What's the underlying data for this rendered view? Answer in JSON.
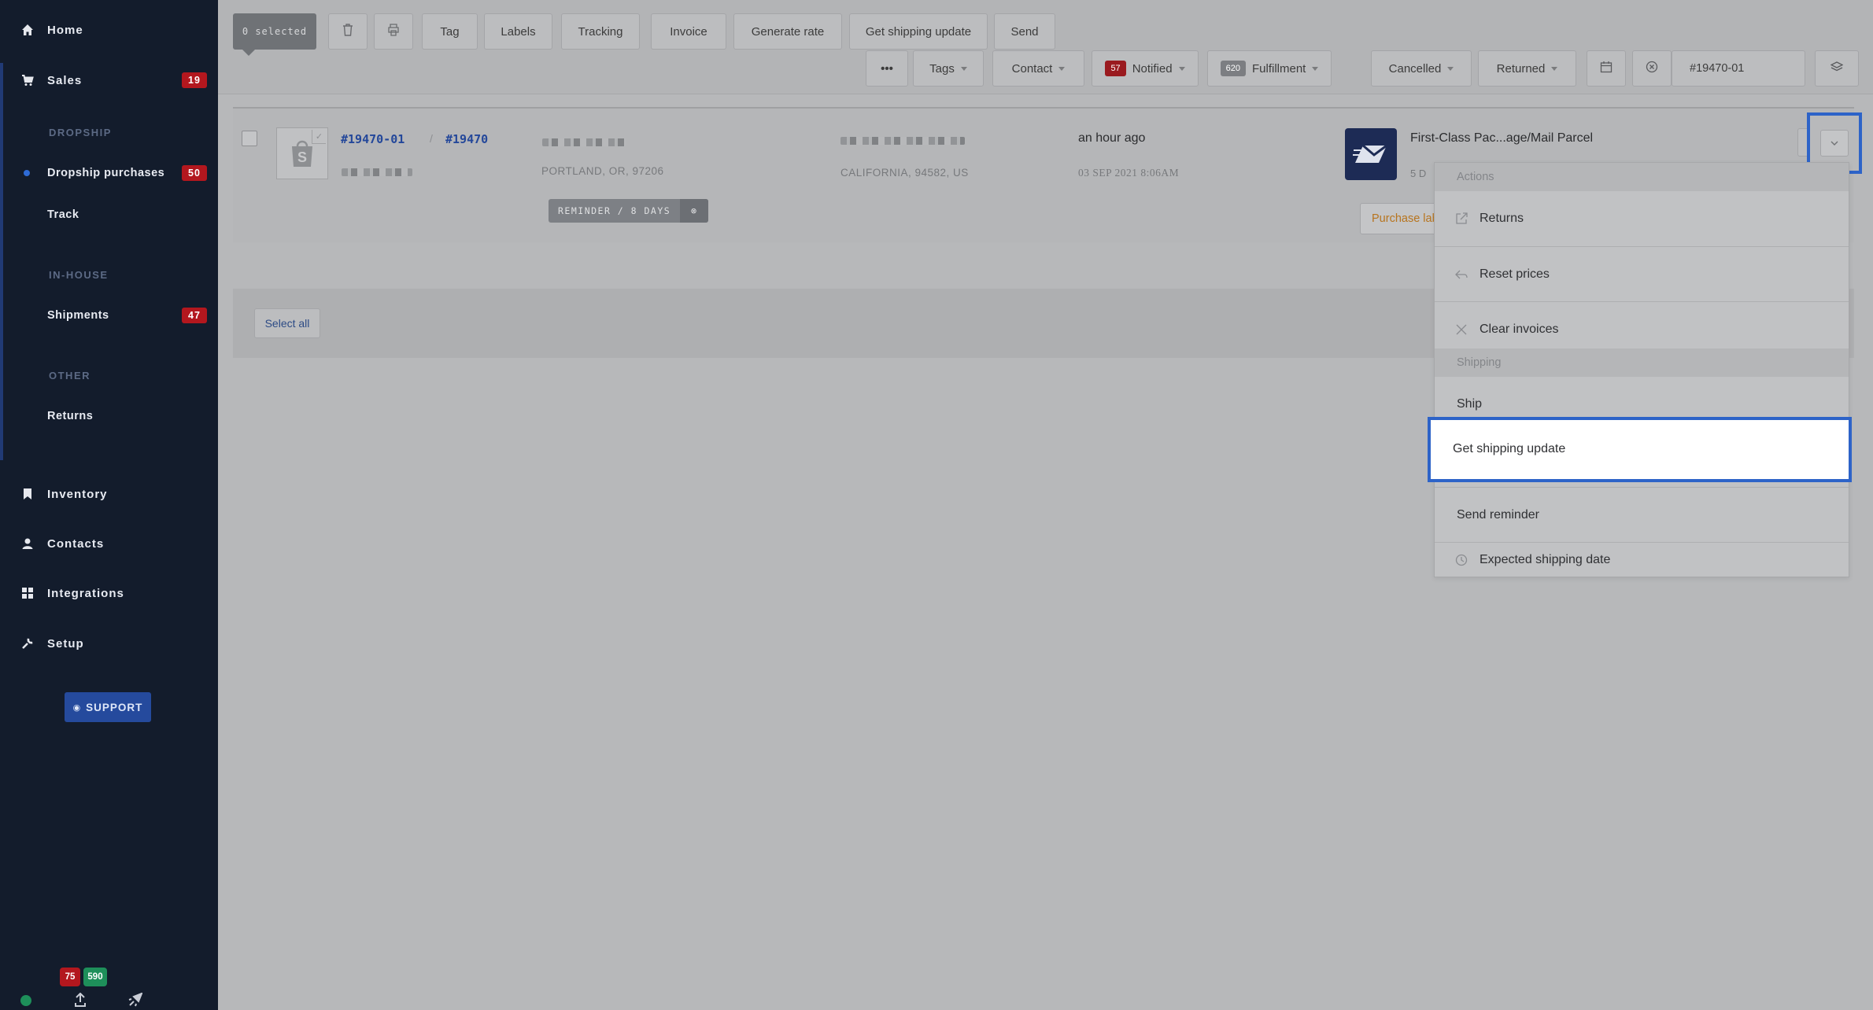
{
  "sidebar": {
    "home": "Home",
    "sales": {
      "label": "Sales",
      "badge": "19"
    },
    "dropship_section": "DROPSHIP",
    "dropship_purchases": {
      "label": "Dropship purchases",
      "badge": "50"
    },
    "track": "Track",
    "inhouse_section": "IN-HOUSE",
    "shipments": {
      "label": "Shipments",
      "badge": "47"
    },
    "other_section": "OTHER",
    "returns": "Returns",
    "inventory": "Inventory",
    "contacts": "Contacts",
    "integrations": "Integrations",
    "setup": "Setup",
    "support": "SUPPORT",
    "bottom_badge_red": "75",
    "bottom_badge_green": "590"
  },
  "toolbar": {
    "selected": "0 selected",
    "tag": "Tag",
    "labels": "Labels",
    "tracking": "Tracking",
    "invoice": "Invoice",
    "generate_rate": "Generate rate",
    "get_shipping_update": "Get shipping update",
    "send": "Send",
    "more": "•••",
    "tags": "Tags",
    "contact": "Contact",
    "notified": {
      "label": "Notified",
      "count": "57"
    },
    "fulfillment": {
      "label": "Fulfillment",
      "count": "620"
    },
    "cancelled": "Cancelled",
    "returned": "Returned",
    "search_value": "#19470-01"
  },
  "order": {
    "id": "#19470-01",
    "parent_id": "#19470",
    "from_location": "PORTLAND, OR, 97206",
    "to_location": "CALIFORNIA, 94582, US",
    "reminder": "REMINDER / 8 DAYS",
    "time_ago": "an hour ago",
    "date": "03 SEP 2021 8:06AM",
    "service": "First-Class Pac...age/Mail Parcel",
    "service_sub": "5  D",
    "purchase_label": "Purchase lab"
  },
  "select_all": "Select all",
  "dropdown": {
    "actions_header": "Actions",
    "returns": "Returns",
    "reset_prices": "Reset prices",
    "clear_invoices": "Clear invoices",
    "shipping_header": "Shipping",
    "ship": "Ship",
    "get_shipping_update": "Get shipping update",
    "send_reminder": "Send reminder",
    "expected_shipping_date": "Expected shipping date"
  },
  "colors": {
    "sidebar_bg": "#131c2c",
    "badge_red": "#b3171e",
    "badge_green": "#1e8f5a",
    "highlight_blue": "#2d63c8",
    "link_blue": "#23479a",
    "support_blue": "#254a9d"
  }
}
